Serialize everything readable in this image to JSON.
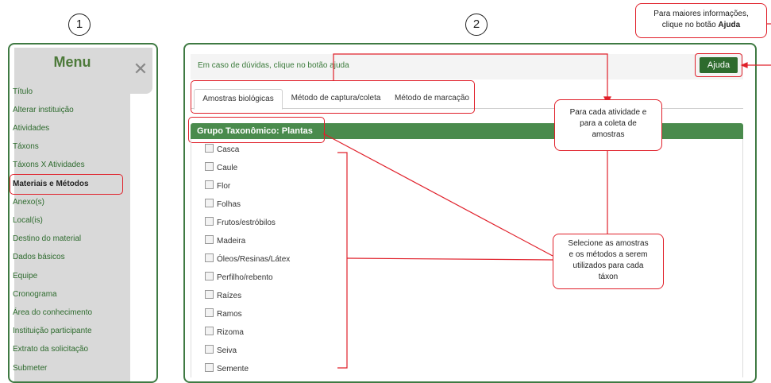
{
  "step_numbers": [
    "1",
    "2"
  ],
  "sidebar": {
    "title": "Menu",
    "items": [
      {
        "label": "Título"
      },
      {
        "label": "Alterar instituição"
      },
      {
        "label": "Atividades"
      },
      {
        "label": "Táxons"
      },
      {
        "label": "Táxons X Atividades"
      },
      {
        "label": "Materiais e Métodos",
        "active": true
      },
      {
        "label": "Anexo(s)"
      },
      {
        "label": "Local(is)"
      },
      {
        "label": "Destino do material"
      },
      {
        "label": "Dados básicos"
      },
      {
        "label": "Equipe"
      },
      {
        "label": "Cronograma"
      },
      {
        "label": "Área do conhecimento"
      },
      {
        "label": "Instituição participante"
      },
      {
        "label": "Extrato da solicitação"
      },
      {
        "label": "Submeter"
      }
    ],
    "close_symbol": "✕"
  },
  "main": {
    "info_text": "Em caso de dúvidas, clique no botão ajuda",
    "help_button": "Ajuda",
    "tabs": [
      {
        "label": "Amostras biológicas",
        "active": true
      },
      {
        "label": "Método de captura/coleta"
      },
      {
        "label": "Método de marcação"
      }
    ],
    "group_title": "Grupo Taxonômico: Plantas",
    "samples": [
      "Casca",
      "Caule",
      "Flor",
      "Folhas",
      "Frutos/estróbilos",
      "Madeira",
      "Óleos/Resinas/Látex",
      "Perfilho/rebento",
      "Raízes",
      "Ramos",
      "Rizoma",
      "Seiva",
      "Semente"
    ]
  },
  "callouts": {
    "help": {
      "line1": "Para maiores informações,",
      "line2_prefix": "clique no botão ",
      "line2_bold": "Ajuda"
    },
    "activity": {
      "line1": "Para cada atividade e",
      "line2": "para a coleta de",
      "line3": "amostras"
    },
    "select": {
      "line1": "Selecione as amostras",
      "line2": "e os métodos a serem",
      "line3": "utilizados para cada",
      "line4": "táxon"
    }
  },
  "colors": {
    "brand_green": "#4a8b4d",
    "highlight_red": "#e0202a"
  },
  "icons": {
    "close": "close-icon",
    "checkbox": "checkbox-icon"
  }
}
